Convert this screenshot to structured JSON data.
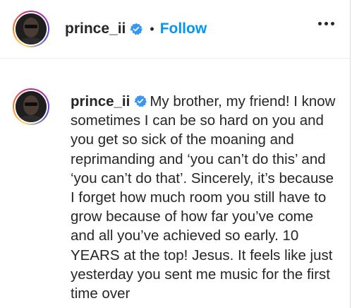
{
  "post_header": {
    "username": "prince_ii",
    "separator": "•",
    "follow_label": "Follow",
    "verified_icon": "verified-badge-icon",
    "more_icon": "more-options-icon"
  },
  "caption": {
    "username": "prince_ii",
    "text": "My brother, my friend! I know sometimes I can be so hard on you and you get so sick of the moaning and reprimanding and ‘you can’t do this’ and ‘you can’t do that’. Sincerely, it’s because I forget how much room you still have to grow because of how far you’ve come and all you’ve achieved so early. 10 YEARS at the top! Jesus. It feels like just yesterday you sent me music for the first time over"
  },
  "colors": {
    "link_blue": "#0095f6",
    "verified_blue": "#3897f0",
    "text": "#262626",
    "border": "#dbdbdb"
  }
}
